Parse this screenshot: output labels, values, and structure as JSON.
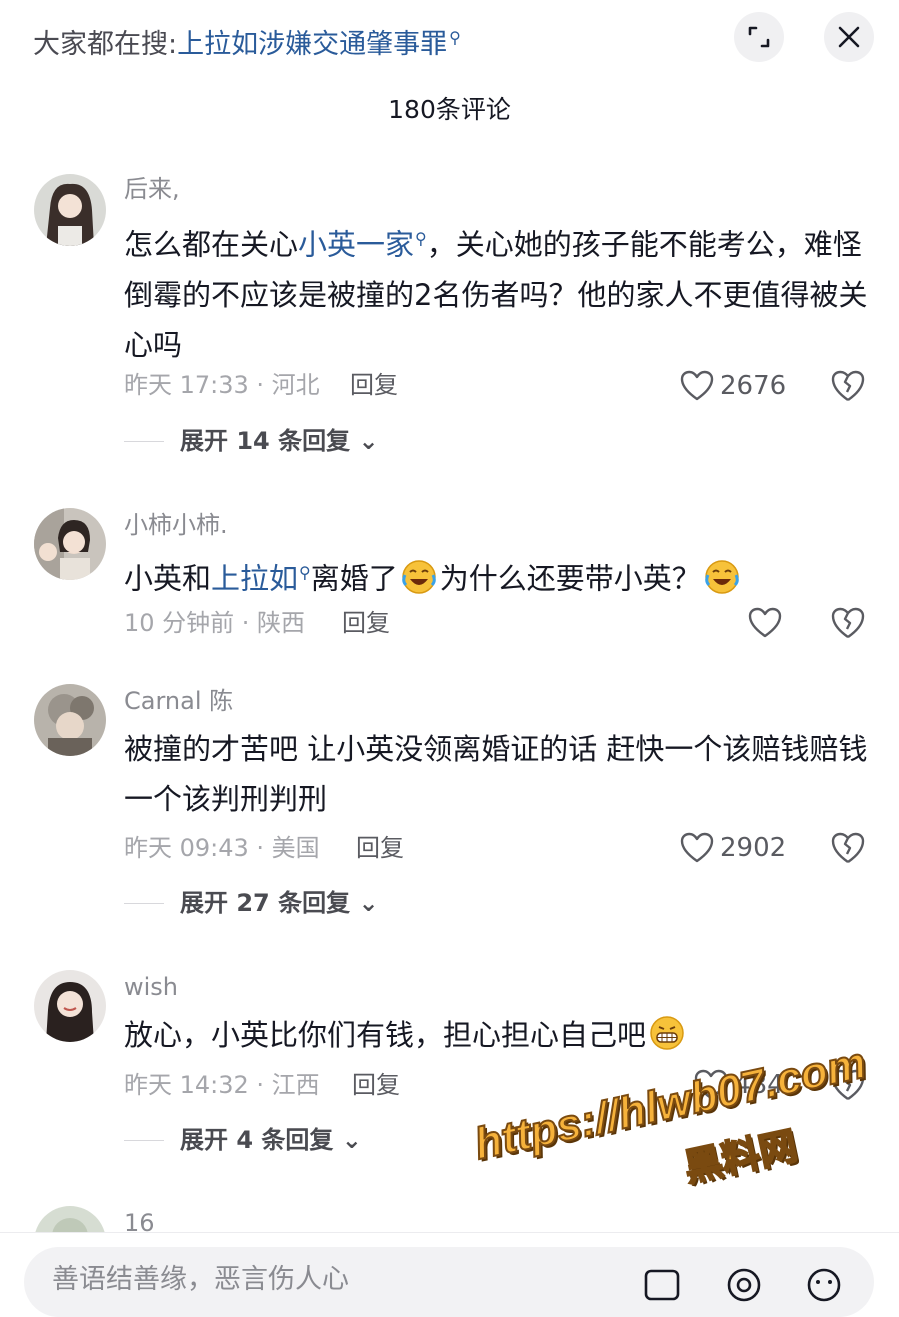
{
  "header": {
    "search_hint_prefix": "大家都在搜:",
    "search_hint_query": "上拉如涉嫌交通肇事罪",
    "search_hint_icon": "search-icon"
  },
  "comment_count_title": "180条评论",
  "comments": [
    {
      "username": "后来,",
      "text_parts": [
        "怎么都在关心",
        "小英一家",
        "，关心她的孩子能不能考公，难怪倒霉的不应该是被撞的2名伤者吗？他的家人不更值得被关心吗"
      ],
      "time_location": "昨天 17:33 · 河北",
      "reply_label": "回复",
      "likes": "2676",
      "expand_label": "展开 14 条回复"
    },
    {
      "username": "小柿小柿.",
      "text_parts": [
        "小英和",
        "上拉如",
        "离婚了",
        "为什么还要带小英？"
      ],
      "time_location": "10 分钟前 · 陕西",
      "reply_label": "回复",
      "likes": ""
    },
    {
      "username": "Carnal 陈",
      "text": "被撞的才苦吧 让小英没领离婚证的话 赶快一个该赔钱赔钱 一个该判刑判刑",
      "time_location": "昨天 09:43 · 美国",
      "reply_label": "回复",
      "likes": "2902",
      "expand_label": "展开 27 条回复"
    },
    {
      "username": "wish",
      "text": "放心，小英比你们有钱，担心担心自己吧",
      "time_location": "昨天 14:32 · 江西",
      "reply_label": "回复",
      "likes": "484",
      "expand_label": "展开 4 条回复"
    },
    {
      "username": "16"
    }
  ],
  "watermark": {
    "url": "https://hlwb07.com",
    "name": "黑料网"
  },
  "input": {
    "placeholder": "善语结善缘，恶言伤人心"
  },
  "colors": {
    "link": "#2a5b9a",
    "watermark": "#f6b23b"
  }
}
